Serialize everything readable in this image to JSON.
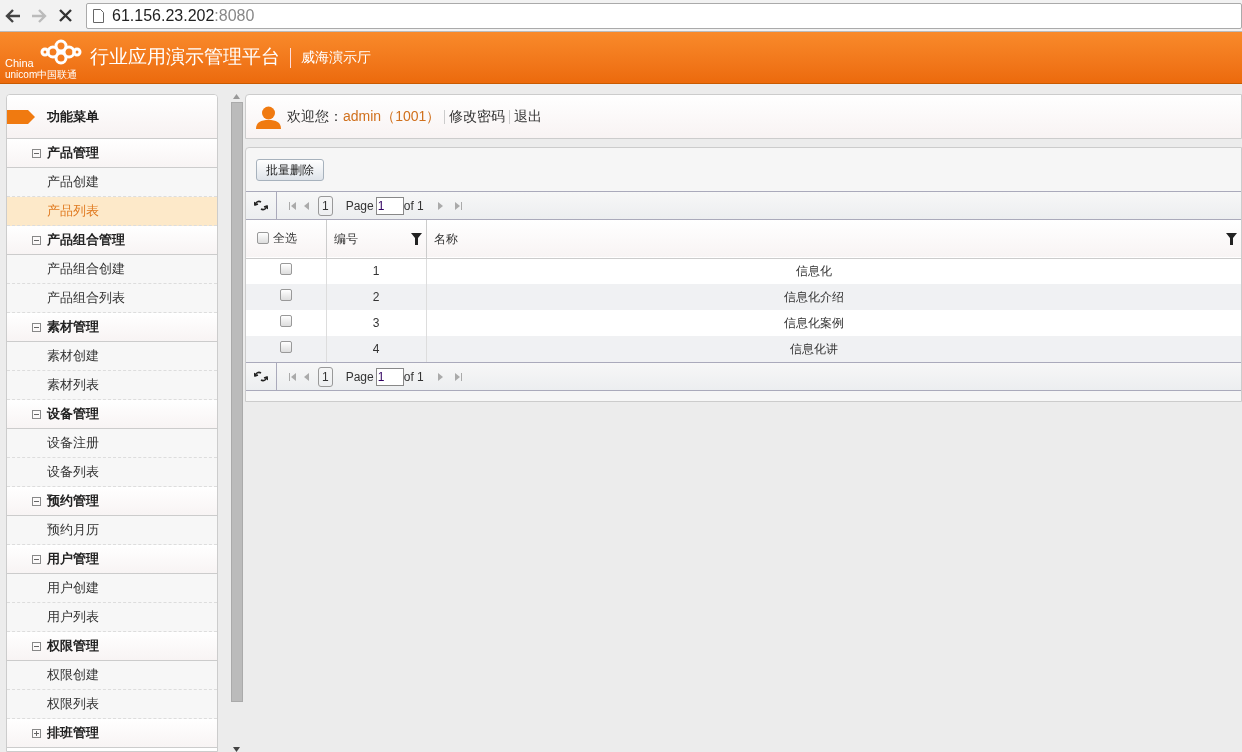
{
  "browser": {
    "url_host": "61.156.23.202",
    "url_port": ":8080"
  },
  "header": {
    "logo_line_1": "China",
    "logo_line_2": "unicom中国联通",
    "title": "行业应用演示管理平台",
    "subtitle": "威海演示厅"
  },
  "sidebar": {
    "title": "功能菜单",
    "groups": [
      {
        "label": "产品管理",
        "expanded": true,
        "children": [
          {
            "label": "产品创建",
            "selected": false
          },
          {
            "label": "产品列表",
            "selected": true
          }
        ]
      },
      {
        "label": "产品组合管理",
        "expanded": true,
        "children": [
          {
            "label": "产品组合创建",
            "selected": false
          },
          {
            "label": "产品组合列表",
            "selected": false
          }
        ]
      },
      {
        "label": "素材管理",
        "expanded": true,
        "children": [
          {
            "label": "素材创建",
            "selected": false
          },
          {
            "label": "素材列表",
            "selected": false
          }
        ]
      },
      {
        "label": "设备管理",
        "expanded": true,
        "children": [
          {
            "label": "设备注册",
            "selected": false
          },
          {
            "label": "设备列表",
            "selected": false
          }
        ]
      },
      {
        "label": "预约管理",
        "expanded": true,
        "children": [
          {
            "label": "预约月历",
            "selected": false
          }
        ]
      },
      {
        "label": "用户管理",
        "expanded": true,
        "children": [
          {
            "label": "用户创建",
            "selected": false
          },
          {
            "label": "用户列表",
            "selected": false
          }
        ]
      },
      {
        "label": "权限管理",
        "expanded": true,
        "children": [
          {
            "label": "权限创建",
            "selected": false
          },
          {
            "label": "权限列表",
            "selected": false
          }
        ]
      },
      {
        "label": "排班管理",
        "expanded": false
      }
    ]
  },
  "userbar": {
    "greeting": "欢迎您：",
    "user": "admin（1001）",
    "links": [
      "修改密码",
      "退出"
    ]
  },
  "toolbar": {
    "button": "批量删除"
  },
  "pagers": [
    {
      "current": "1",
      "page_label": "Page",
      "page_input": "1",
      "of_label": "of 1"
    },
    {
      "current": "1",
      "page_label": "Page",
      "page_input": "1",
      "of_label": "of 1"
    }
  ],
  "table": {
    "select_all": {
      "label": "全选",
      "checked": false
    },
    "columns": [
      {
        "label": "编号",
        "filter": true
      },
      {
        "label": "名称",
        "filter": true
      }
    ],
    "rows": [
      {
        "checked": false,
        "id": "1",
        "name": "信息化"
      },
      {
        "checked": false,
        "id": "2",
        "name": "信息化介绍"
      },
      {
        "checked": false,
        "id": "3",
        "name": "信息化案例"
      },
      {
        "checked": false,
        "id": "4",
        "name": "信息化讲"
      }
    ]
  }
}
